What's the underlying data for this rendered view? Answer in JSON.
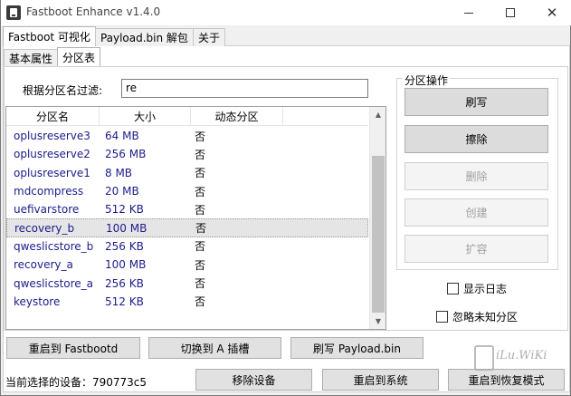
{
  "window": {
    "title": "Fastboot Enhance v1.4.0",
    "controls": {
      "minimize": "minimize",
      "maximize": "maximize",
      "close": "✕"
    }
  },
  "main_tabs": [
    {
      "label": "Fastboot 可视化",
      "active": true
    },
    {
      "label": "Payload.bin 解包",
      "active": false
    },
    {
      "label": "关于",
      "active": false
    }
  ],
  "sub_tabs": [
    {
      "label": "基本属性",
      "active": false
    },
    {
      "label": "分区表",
      "active": true
    }
  ],
  "filter": {
    "label": "根据分区名过滤:",
    "value": "re"
  },
  "table": {
    "columns": [
      "分区名",
      "大小",
      "动态分区",
      ""
    ],
    "rows": [
      {
        "name": "oplusreserve3",
        "size": "64 MB",
        "dynamic": "否",
        "selected": false
      },
      {
        "name": "oplusreserve2",
        "size": "256 MB",
        "dynamic": "否",
        "selected": false
      },
      {
        "name": "oplusreserve1",
        "size": "8 MB",
        "dynamic": "否",
        "selected": false
      },
      {
        "name": "mdcompress",
        "size": "20 MB",
        "dynamic": "否",
        "selected": false
      },
      {
        "name": "uefivarstore",
        "size": "512 KB",
        "dynamic": "否",
        "selected": false
      },
      {
        "name": "recovery_b",
        "size": "100 MB",
        "dynamic": "否",
        "selected": true
      },
      {
        "name": "qweslicstore_b",
        "size": "256 KB",
        "dynamic": "否",
        "selected": false
      },
      {
        "name": "recovery_a",
        "size": "100 MB",
        "dynamic": "否",
        "selected": false
      },
      {
        "name": "qweslicstore_a",
        "size": "256 KB",
        "dynamic": "否",
        "selected": false
      },
      {
        "name": "keystore",
        "size": "512 KB",
        "dynamic": "否",
        "selected": false
      }
    ]
  },
  "partition_ops": {
    "title": "分区操作",
    "buttons": [
      {
        "label": "刷写",
        "enabled": true
      },
      {
        "label": "擦除",
        "enabled": true
      },
      {
        "label": "删除",
        "enabled": false
      },
      {
        "label": "创建",
        "enabled": false
      },
      {
        "label": "扩容",
        "enabled": false
      }
    ]
  },
  "options": {
    "show_log": "显示日志",
    "ignore_unknown": "忽略未知分区"
  },
  "actions": {
    "reboot_fastbootd": "重启到 Fastbootd",
    "switch_slot_a": "切换到 A 插槽",
    "flash_payload": "刷写 Payload.bin",
    "remove_device": "移除设备",
    "reboot_system": "重启到系统",
    "reboot_recovery": "重启到恢复模式"
  },
  "status": {
    "current_device": "当前选择的设备：790773c5"
  },
  "watermark": {
    "text": "iLu.WiKi"
  }
}
